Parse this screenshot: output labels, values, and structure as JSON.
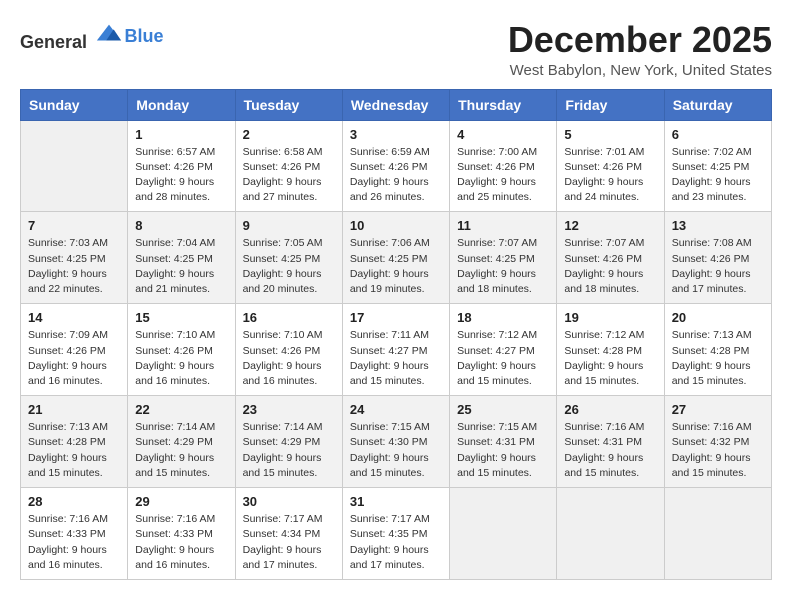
{
  "logo": {
    "general": "General",
    "blue": "Blue"
  },
  "title": "December 2025",
  "location": "West Babylon, New York, United States",
  "days_of_week": [
    "Sunday",
    "Monday",
    "Tuesday",
    "Wednesday",
    "Thursday",
    "Friday",
    "Saturday"
  ],
  "weeks": [
    [
      {
        "day": "",
        "sunrise": "",
        "sunset": "",
        "daylight": ""
      },
      {
        "day": "1",
        "sunrise": "Sunrise: 6:57 AM",
        "sunset": "Sunset: 4:26 PM",
        "daylight": "Daylight: 9 hours and 28 minutes."
      },
      {
        "day": "2",
        "sunrise": "Sunrise: 6:58 AM",
        "sunset": "Sunset: 4:26 PM",
        "daylight": "Daylight: 9 hours and 27 minutes."
      },
      {
        "day": "3",
        "sunrise": "Sunrise: 6:59 AM",
        "sunset": "Sunset: 4:26 PM",
        "daylight": "Daylight: 9 hours and 26 minutes."
      },
      {
        "day": "4",
        "sunrise": "Sunrise: 7:00 AM",
        "sunset": "Sunset: 4:26 PM",
        "daylight": "Daylight: 9 hours and 25 minutes."
      },
      {
        "day": "5",
        "sunrise": "Sunrise: 7:01 AM",
        "sunset": "Sunset: 4:26 PM",
        "daylight": "Daylight: 9 hours and 24 minutes."
      },
      {
        "day": "6",
        "sunrise": "Sunrise: 7:02 AM",
        "sunset": "Sunset: 4:25 PM",
        "daylight": "Daylight: 9 hours and 23 minutes."
      }
    ],
    [
      {
        "day": "7",
        "sunrise": "Sunrise: 7:03 AM",
        "sunset": "Sunset: 4:25 PM",
        "daylight": "Daylight: 9 hours and 22 minutes."
      },
      {
        "day": "8",
        "sunrise": "Sunrise: 7:04 AM",
        "sunset": "Sunset: 4:25 PM",
        "daylight": "Daylight: 9 hours and 21 minutes."
      },
      {
        "day": "9",
        "sunrise": "Sunrise: 7:05 AM",
        "sunset": "Sunset: 4:25 PM",
        "daylight": "Daylight: 9 hours and 20 minutes."
      },
      {
        "day": "10",
        "sunrise": "Sunrise: 7:06 AM",
        "sunset": "Sunset: 4:25 PM",
        "daylight": "Daylight: 9 hours and 19 minutes."
      },
      {
        "day": "11",
        "sunrise": "Sunrise: 7:07 AM",
        "sunset": "Sunset: 4:25 PM",
        "daylight": "Daylight: 9 hours and 18 minutes."
      },
      {
        "day": "12",
        "sunrise": "Sunrise: 7:07 AM",
        "sunset": "Sunset: 4:26 PM",
        "daylight": "Daylight: 9 hours and 18 minutes."
      },
      {
        "day": "13",
        "sunrise": "Sunrise: 7:08 AM",
        "sunset": "Sunset: 4:26 PM",
        "daylight": "Daylight: 9 hours and 17 minutes."
      }
    ],
    [
      {
        "day": "14",
        "sunrise": "Sunrise: 7:09 AM",
        "sunset": "Sunset: 4:26 PM",
        "daylight": "Daylight: 9 hours and 16 minutes."
      },
      {
        "day": "15",
        "sunrise": "Sunrise: 7:10 AM",
        "sunset": "Sunset: 4:26 PM",
        "daylight": "Daylight: 9 hours and 16 minutes."
      },
      {
        "day": "16",
        "sunrise": "Sunrise: 7:10 AM",
        "sunset": "Sunset: 4:26 PM",
        "daylight": "Daylight: 9 hours and 16 minutes."
      },
      {
        "day": "17",
        "sunrise": "Sunrise: 7:11 AM",
        "sunset": "Sunset: 4:27 PM",
        "daylight": "Daylight: 9 hours and 15 minutes."
      },
      {
        "day": "18",
        "sunrise": "Sunrise: 7:12 AM",
        "sunset": "Sunset: 4:27 PM",
        "daylight": "Daylight: 9 hours and 15 minutes."
      },
      {
        "day": "19",
        "sunrise": "Sunrise: 7:12 AM",
        "sunset": "Sunset: 4:28 PM",
        "daylight": "Daylight: 9 hours and 15 minutes."
      },
      {
        "day": "20",
        "sunrise": "Sunrise: 7:13 AM",
        "sunset": "Sunset: 4:28 PM",
        "daylight": "Daylight: 9 hours and 15 minutes."
      }
    ],
    [
      {
        "day": "21",
        "sunrise": "Sunrise: 7:13 AM",
        "sunset": "Sunset: 4:28 PM",
        "daylight": "Daylight: 9 hours and 15 minutes."
      },
      {
        "day": "22",
        "sunrise": "Sunrise: 7:14 AM",
        "sunset": "Sunset: 4:29 PM",
        "daylight": "Daylight: 9 hours and 15 minutes."
      },
      {
        "day": "23",
        "sunrise": "Sunrise: 7:14 AM",
        "sunset": "Sunset: 4:29 PM",
        "daylight": "Daylight: 9 hours and 15 minutes."
      },
      {
        "day": "24",
        "sunrise": "Sunrise: 7:15 AM",
        "sunset": "Sunset: 4:30 PM",
        "daylight": "Daylight: 9 hours and 15 minutes."
      },
      {
        "day": "25",
        "sunrise": "Sunrise: 7:15 AM",
        "sunset": "Sunset: 4:31 PM",
        "daylight": "Daylight: 9 hours and 15 minutes."
      },
      {
        "day": "26",
        "sunrise": "Sunrise: 7:16 AM",
        "sunset": "Sunset: 4:31 PM",
        "daylight": "Daylight: 9 hours and 15 minutes."
      },
      {
        "day": "27",
        "sunrise": "Sunrise: 7:16 AM",
        "sunset": "Sunset: 4:32 PM",
        "daylight": "Daylight: 9 hours and 15 minutes."
      }
    ],
    [
      {
        "day": "28",
        "sunrise": "Sunrise: 7:16 AM",
        "sunset": "Sunset: 4:33 PM",
        "daylight": "Daylight: 9 hours and 16 minutes."
      },
      {
        "day": "29",
        "sunrise": "Sunrise: 7:16 AM",
        "sunset": "Sunset: 4:33 PM",
        "daylight": "Daylight: 9 hours and 16 minutes."
      },
      {
        "day": "30",
        "sunrise": "Sunrise: 7:17 AM",
        "sunset": "Sunset: 4:34 PM",
        "daylight": "Daylight: 9 hours and 17 minutes."
      },
      {
        "day": "31",
        "sunrise": "Sunrise: 7:17 AM",
        "sunset": "Sunset: 4:35 PM",
        "daylight": "Daylight: 9 hours and 17 minutes."
      },
      {
        "day": "",
        "sunrise": "",
        "sunset": "",
        "daylight": ""
      },
      {
        "day": "",
        "sunrise": "",
        "sunset": "",
        "daylight": ""
      },
      {
        "day": "",
        "sunrise": "",
        "sunset": "",
        "daylight": ""
      }
    ]
  ]
}
